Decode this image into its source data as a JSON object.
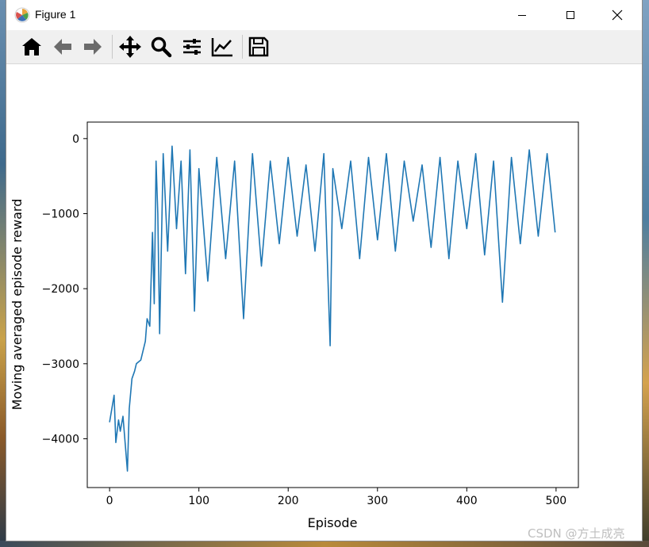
{
  "window": {
    "title": "Figure 1",
    "controls": {
      "minimize": "minimize",
      "maximize": "maximize",
      "close": "close"
    }
  },
  "toolbar": {
    "tools": [
      {
        "name": "home-icon"
      },
      {
        "name": "back-arrow-icon"
      },
      {
        "name": "forward-arrow-icon"
      },
      {
        "name": "pan-icon"
      },
      {
        "name": "zoom-icon"
      },
      {
        "name": "configure-subplots-icon"
      },
      {
        "name": "edit-axis-icon"
      },
      {
        "name": "save-icon"
      }
    ],
    "enabled_color": "#000000",
    "disabled_color": "#6b6b6b"
  },
  "watermark": "CSDN @方土成亮",
  "chart_data": {
    "type": "line",
    "title": "",
    "xlabel": "Episode",
    "ylabel": "Moving averaged episode reward",
    "xlim": [
      -25,
      525
    ],
    "ylim": [
      -4650,
      220
    ],
    "xticks": [
      0,
      100,
      200,
      300,
      400,
      500
    ],
    "xtick_labels": [
      "0",
      "100",
      "200",
      "300",
      "400",
      "500"
    ],
    "yticks": [
      0,
      -1000,
      -2000,
      -3000,
      -4000
    ],
    "ytick_labels": [
      "0",
      "−1000",
      "−2000",
      "−3000",
      "−4000"
    ],
    "grid": false,
    "legend": "none",
    "series": [
      {
        "color": "#1f77b4",
        "x": [
          0,
          5,
          7,
          10,
          12,
          15,
          20,
          22,
          25,
          28,
          30,
          35,
          40,
          42,
          45,
          48,
          50,
          52,
          54,
          56,
          60,
          65,
          70,
          75,
          80,
          85,
          90,
          95,
          100,
          110,
          120,
          130,
          140,
          150,
          160,
          170,
          180,
          190,
          200,
          210,
          220,
          230,
          240,
          247,
          250,
          260,
          270,
          280,
          290,
          300,
          310,
          320,
          330,
          340,
          350,
          360,
          370,
          380,
          390,
          400,
          410,
          420,
          430,
          440,
          450,
          460,
          470,
          480,
          490,
          499
        ],
        "y": [
          -3780,
          -3420,
          -4050,
          -3750,
          -3900,
          -3700,
          -4430,
          -3600,
          -3200,
          -3100,
          -3000,
          -2950,
          -2700,
          -2400,
          -2500,
          -1250,
          -2200,
          -300,
          -1000,
          -2600,
          -200,
          -1500,
          -100,
          -1200,
          -300,
          -1800,
          -150,
          -2300,
          -400,
          -1900,
          -250,
          -1600,
          -300,
          -2400,
          -200,
          -1700,
          -300,
          -1400,
          -250,
          -1300,
          -350,
          -1500,
          -200,
          -2760,
          -400,
          -1200,
          -300,
          -1600,
          -250,
          -1350,
          -200,
          -1500,
          -300,
          -1100,
          -350,
          -1450,
          -250,
          -1600,
          -300,
          -1200,
          -200,
          -1550,
          -300,
          -2180,
          -250,
          -1400,
          -150,
          -1300,
          -200,
          -1250
        ]
      }
    ]
  }
}
